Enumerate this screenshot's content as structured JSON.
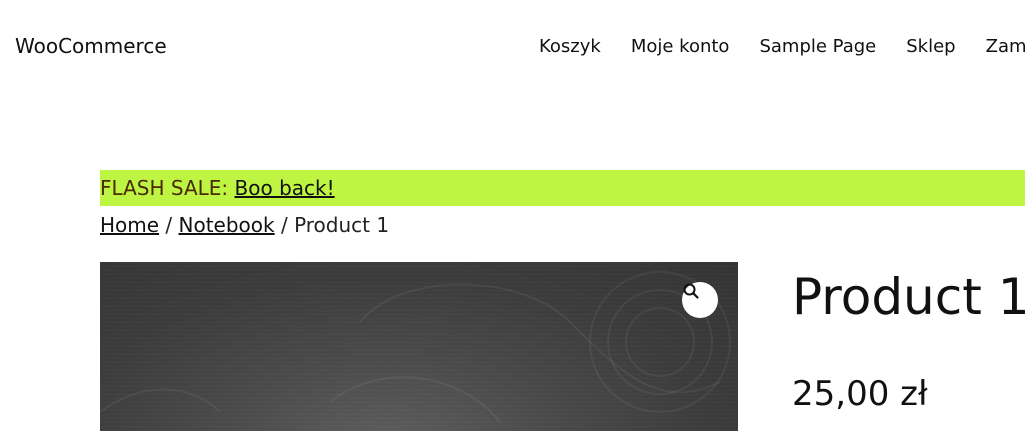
{
  "header": {
    "site_title": "WooCommerce",
    "nav": [
      "Koszyk",
      "Moje konto",
      "Sample Page",
      "Sklep",
      "Zamówienie"
    ]
  },
  "banner": {
    "prefix": "FLASH SALE: ",
    "link": "Boo back!"
  },
  "breadcrumb": {
    "home": "Home",
    "sep1": " / ",
    "category": "Notebook",
    "sep2": " / ",
    "current": "Product 1"
  },
  "gallery": {
    "zoom_icon": "search-icon"
  },
  "product": {
    "title": "Product 1",
    "price": "25,00 zł"
  },
  "colors": {
    "banner_bg": "#bef442",
    "banner_text": "#4a2a06",
    "image_bg": "#3f3f3f"
  }
}
